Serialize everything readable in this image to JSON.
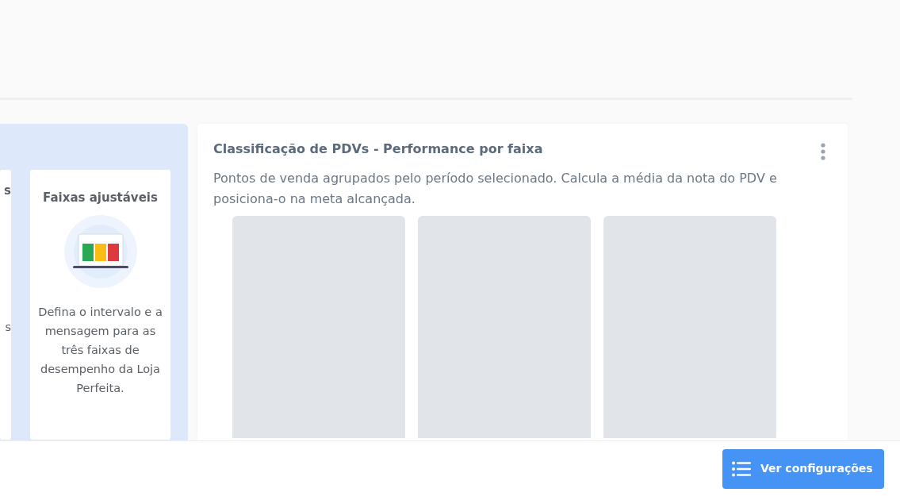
{
  "left_panel": {
    "cards": [
      {
        "kind": "cut",
        "title": "s",
        "body": "s"
      },
      {
        "kind": "feature",
        "title": "Faixas ajustáveis",
        "body": "Defina o intervalo e a mensagem para as três faixas de desempenho da Loja Perfeita."
      }
    ]
  },
  "classification_card": {
    "title": "Classificação de PDVs - Performance por faixa",
    "description": "Pontos de venda agrupados pelo período selecionado. Calcula a média da nota do PDV e posiciona-o na meta alcançada.",
    "placeholders": [
      {
        "kind": "loading"
      },
      {
        "kind": "loading"
      },
      {
        "kind": "loading"
      }
    ]
  },
  "footer": {
    "button": "Ver configurações"
  }
}
